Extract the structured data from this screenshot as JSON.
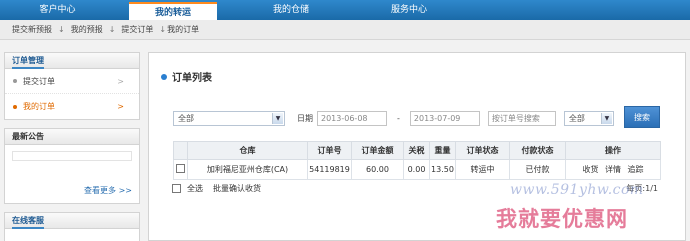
{
  "topnav": {
    "tabs": [
      {
        "label": "客户中心"
      },
      {
        "label": "我的转运"
      },
      {
        "label": "我的仓储"
      },
      {
        "label": "服务中心"
      }
    ]
  },
  "subnav": {
    "items": [
      "提交新预报",
      "我的预报",
      "提交订单",
      "我的订单"
    ]
  },
  "sidebar": {
    "section_title": "订单管理",
    "items": [
      {
        "label": "提交订单"
      },
      {
        "label": "我的订单"
      }
    ],
    "notice_title": "最新公告",
    "more_label": "查看更多 >>",
    "kefu_title": "在线客服"
  },
  "main": {
    "title": "订单列表",
    "filters": {
      "warehouse_select": "全部",
      "date_label": "日期",
      "date_from": "2013-06-08",
      "date_sep": "-",
      "date_to": "2013-07-09",
      "search_placeholder": "按订单号搜索",
      "status_select": "全部",
      "search_button": "搜索"
    },
    "table": {
      "columns": [
        "",
        "仓库",
        "订单号",
        "订单金额",
        "关税",
        "重量",
        "订单状态",
        "付款状态",
        "操作"
      ],
      "rows": [
        {
          "warehouse": "加利福尼亚州仓库(CA)",
          "order_no": "54119819",
          "amount": "60.00",
          "tax": "0.00",
          "weight": "13.50",
          "status": "转运中",
          "payment": "已付款",
          "actions": [
            "收货",
            "详情",
            "追踪"
          ]
        }
      ]
    },
    "select_all": "全选",
    "bulk_action": "批量确认收货",
    "pagination": "每页:1/1"
  },
  "watermark": {
    "url": "www.591yhw.com",
    "text": "我就要优惠网"
  }
}
